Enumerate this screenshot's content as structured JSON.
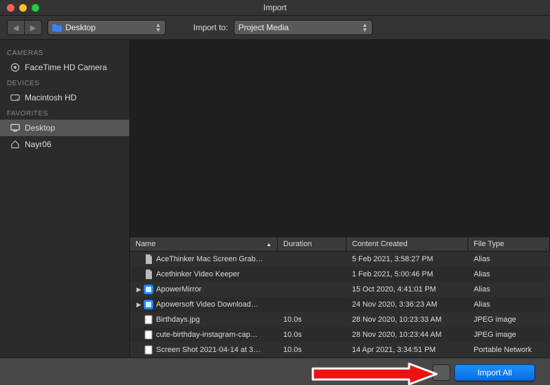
{
  "window": {
    "title": "Import"
  },
  "toolbar": {
    "location_label": "Desktop",
    "import_to_label": "Import to:",
    "import_to_value": "Project Media"
  },
  "sidebar": {
    "sections": [
      {
        "header": "CAMERAS",
        "items": [
          {
            "label": "FaceTime HD Camera",
            "icon": "camera"
          }
        ]
      },
      {
        "header": "DEVICES",
        "items": [
          {
            "label": "Macintosh HD",
            "icon": "hdd"
          }
        ]
      },
      {
        "header": "FAVORITES",
        "items": [
          {
            "label": "Desktop",
            "icon": "desktop",
            "selected": true
          },
          {
            "label": "Nayr06",
            "icon": "home"
          }
        ]
      }
    ]
  },
  "table": {
    "columns": {
      "name": "Name",
      "duration": "Duration",
      "created": "Content Created",
      "type": "File Type"
    },
    "rows": [
      {
        "disclose": "",
        "icon": "doc",
        "name": "AceThinker Mac Screen Grab…",
        "duration": "",
        "created": "5 Feb 2021, 3:58:27 PM",
        "type": "Alias"
      },
      {
        "disclose": "",
        "icon": "doc",
        "name": "Acethinker Video Keeper",
        "duration": "",
        "created": "1 Feb 2021, 5:00:46 PM",
        "type": "Alias"
      },
      {
        "disclose": "▶",
        "icon": "app-b",
        "name": "ApowerMirror",
        "duration": "",
        "created": "15 Oct 2020, 4:41:01 PM",
        "type": "Alias"
      },
      {
        "disclose": "▶",
        "icon": "app-b",
        "name": "Apowersoft Video Download…",
        "duration": "",
        "created": "24 Nov 2020, 3:36:23 AM",
        "type": "Alias"
      },
      {
        "disclose": "",
        "icon": "img",
        "name": "Birthdays.jpg",
        "duration": "10.0s",
        "created": "28 Nov 2020, 10:23:33 AM",
        "type": "JPEG image"
      },
      {
        "disclose": "",
        "icon": "img",
        "name": "cute-birthday-instagram-cap…",
        "duration": "10.0s",
        "created": "28 Nov 2020, 10:23:44 AM",
        "type": "JPEG image"
      },
      {
        "disclose": "",
        "icon": "img",
        "name": "Screen Shot 2021-04-14 at 3…",
        "duration": "10.0s",
        "created": "14 Apr 2021, 3:34:51 PM",
        "type": "Portable Network"
      }
    ]
  },
  "footer": {
    "primary_button": "Import All"
  }
}
